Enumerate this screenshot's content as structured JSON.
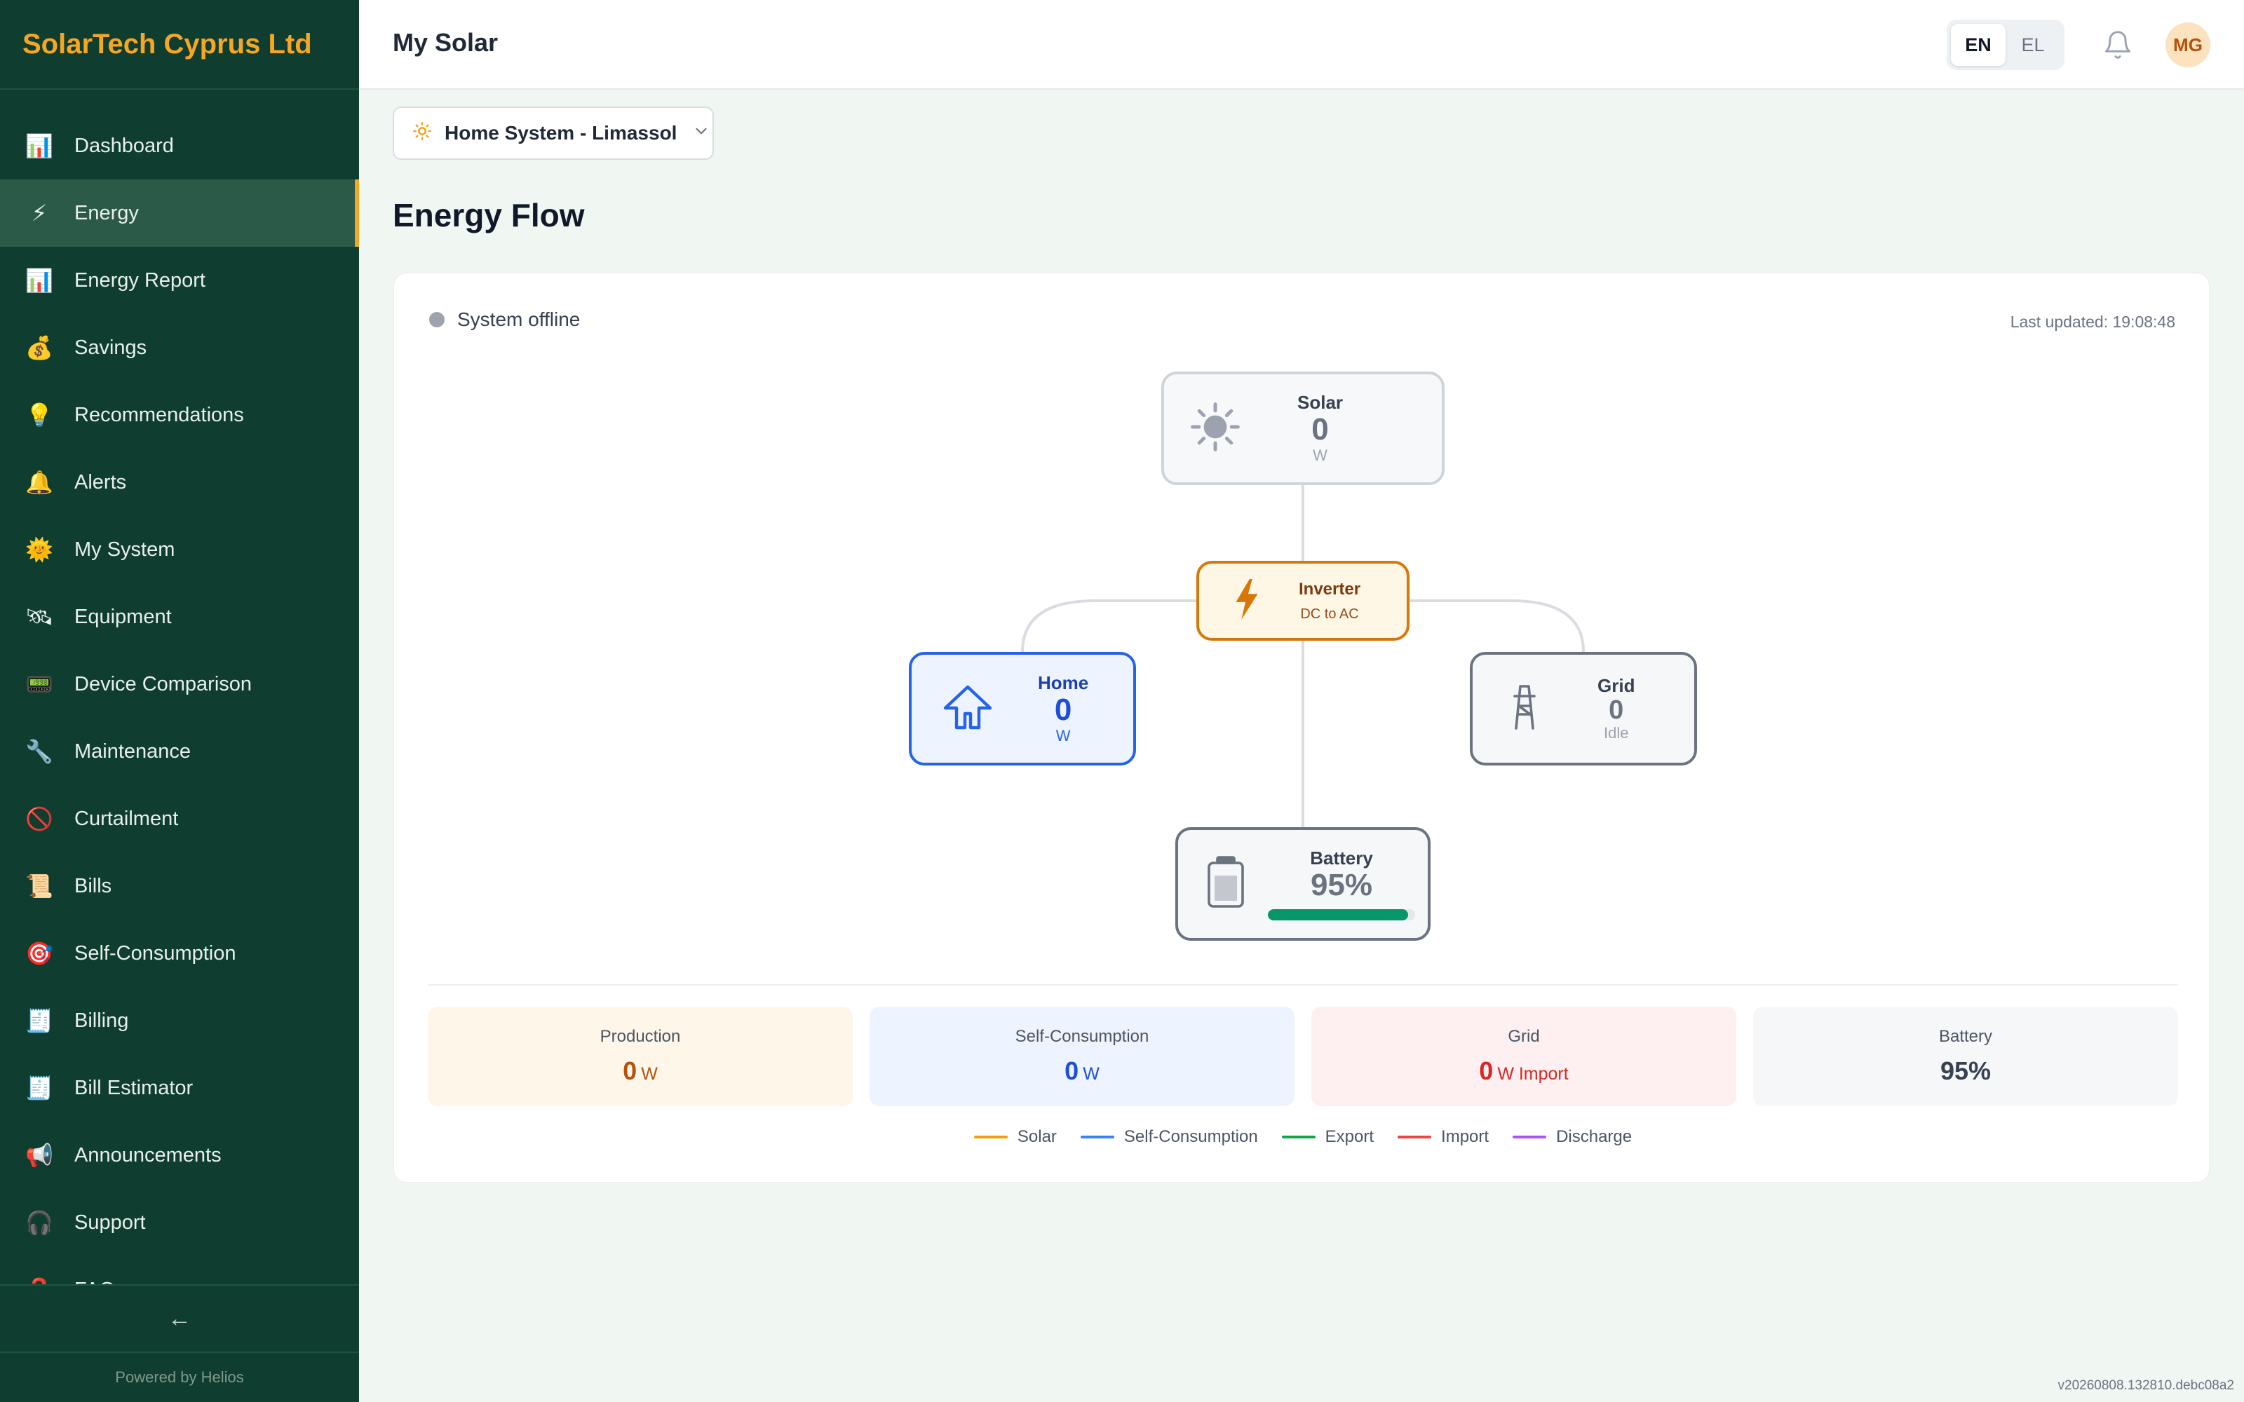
{
  "brand": {
    "name": "SolarTech Cyprus Ltd"
  },
  "sidebar": {
    "items": [
      {
        "label": "Dashboard",
        "icon": "bar-chart-icon",
        "glyph": "📊",
        "active": false
      },
      {
        "label": "Energy",
        "icon": "lightning-icon",
        "glyph": "⚡",
        "active": true
      },
      {
        "label": "Energy Report",
        "icon": "bar-chart-icon",
        "glyph": "📊",
        "active": false
      },
      {
        "label": "Savings",
        "icon": "money-bag-icon",
        "glyph": "💰",
        "active": false
      },
      {
        "label": "Recommendations",
        "icon": "light-bulb-icon",
        "glyph": "💡",
        "active": false
      },
      {
        "label": "Alerts",
        "icon": "bell-icon",
        "glyph": "🔔",
        "active": false
      },
      {
        "label": "My System",
        "icon": "sun-icon",
        "glyph": "🌞",
        "active": false
      },
      {
        "label": "Equipment",
        "icon": "satellite-icon",
        "glyph": "🛰",
        "active": false
      },
      {
        "label": "Device Comparison",
        "icon": "monitor-icon",
        "glyph": "📟",
        "active": false
      },
      {
        "label": "Maintenance",
        "icon": "wrench-icon",
        "glyph": "🔧",
        "active": false
      },
      {
        "label": "Curtailment",
        "icon": "prohibited-icon",
        "glyph": "🚫",
        "active": false
      },
      {
        "label": "Bills",
        "icon": "scroll-icon",
        "glyph": "📜",
        "active": false
      },
      {
        "label": "Self-Consumption",
        "icon": "target-icon",
        "glyph": "🎯",
        "active": false
      },
      {
        "label": "Billing",
        "icon": "receipt-icon",
        "glyph": "🧾",
        "active": false
      },
      {
        "label": "Bill Estimator",
        "icon": "receipt-icon",
        "glyph": "🧾",
        "active": false
      },
      {
        "label": "Announcements",
        "icon": "megaphone-icon",
        "glyph": "📢",
        "active": false
      },
      {
        "label": "Support",
        "icon": "headphones-icon",
        "glyph": "🎧",
        "active": false
      },
      {
        "label": "FAQ",
        "icon": "question-icon",
        "glyph": "❓",
        "active": false
      }
    ],
    "collapse_glyph": "←",
    "powered_by": "Powered by Helios"
  },
  "header": {
    "title": "My Solar",
    "languages": [
      "EN",
      "EL"
    ],
    "active_language": "EN",
    "avatar_initials": "MG"
  },
  "system_selector": {
    "label": "Home System - Limassol"
  },
  "main": {
    "section_title": "Energy Flow",
    "status": "System offline",
    "last_updated": "Last updated: 19:08:48"
  },
  "flow": {
    "solar": {
      "label": "Solar",
      "value": "0",
      "unit": "W"
    },
    "inverter": {
      "label": "Inverter",
      "sub": "DC to AC"
    },
    "home": {
      "label": "Home",
      "value": "0",
      "unit": "W"
    },
    "grid": {
      "label": "Grid",
      "value": "0",
      "status": "Idle"
    },
    "battery": {
      "label": "Battery",
      "value": "95%",
      "level": 0.95
    }
  },
  "stats": {
    "production": {
      "label": "Production",
      "value": "0",
      "unit": "W"
    },
    "self_consumption": {
      "label": "Self-Consumption",
      "value": "0",
      "unit": "W"
    },
    "grid": {
      "label": "Grid",
      "value": "0",
      "unit": "W Import"
    },
    "battery": {
      "label": "Battery",
      "value": "95%"
    }
  },
  "legend": [
    {
      "label": "Solar",
      "color": "#f59e0b"
    },
    {
      "label": "Self-Consumption",
      "color": "#3b82f6"
    },
    {
      "label": "Export",
      "color": "#16a34a"
    },
    {
      "label": "Import",
      "color": "#ef4444"
    },
    {
      "label": "Discharge",
      "color": "#a855f7"
    }
  ],
  "version": "v20260808.132810.debc08a2"
}
